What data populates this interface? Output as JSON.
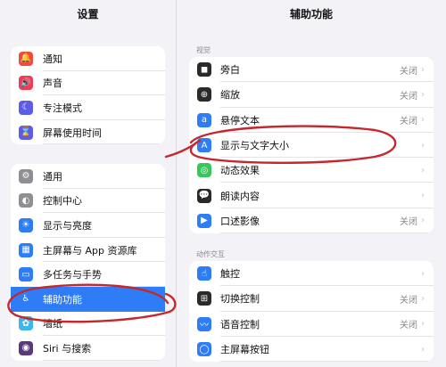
{
  "sidebar": {
    "title": "设置",
    "group1": [
      {
        "label": "通知",
        "icon": "bell-icon",
        "color": "#f24b3e",
        "glyph": "🔔"
      },
      {
        "label": "声音",
        "icon": "speaker-icon",
        "color": "#f23b54",
        "glyph": "🔊"
      },
      {
        "label": "专注模式",
        "icon": "moon-icon",
        "color": "#5e5ce6",
        "glyph": "☾"
      },
      {
        "label": "屏幕使用时间",
        "icon": "hourglass-icon",
        "color": "#5e5ce6",
        "glyph": "⌛"
      }
    ],
    "group2": [
      {
        "label": "通用",
        "icon": "gear-icon",
        "color": "#8e8e93",
        "glyph": "⚙"
      },
      {
        "label": "控制中心",
        "icon": "toggles-icon",
        "color": "#8e8e93",
        "glyph": "◐"
      },
      {
        "label": "显示与亮度",
        "icon": "sun-icon",
        "color": "#2e7df6",
        "glyph": "☀"
      },
      {
        "label": "主屏幕与 App 资源库",
        "icon": "home-grid-icon",
        "color": "#2e7df6",
        "glyph": "▦"
      },
      {
        "label": "多任务与手势",
        "icon": "multitask-icon",
        "color": "#2e7df6",
        "glyph": "▭"
      },
      {
        "label": "辅助功能",
        "icon": "accessibility-icon",
        "color": "#2e7df6",
        "glyph": "♿",
        "selected": true
      },
      {
        "label": "墙纸",
        "icon": "flower-icon",
        "color": "#3fb6e8",
        "glyph": "✿"
      },
      {
        "label": "Siri 与搜索",
        "icon": "siri-icon",
        "color": "#5a3b7a",
        "glyph": "◉"
      }
    ]
  },
  "detail": {
    "title": "辅助功能",
    "section1_header": "视觉",
    "section1": [
      {
        "label": "旁白",
        "value": "关闭",
        "icon": "voiceover-icon",
        "color": "#2a2a2a",
        "glyph": "◼"
      },
      {
        "label": "缩放",
        "value": "关闭",
        "icon": "zoom-icon",
        "color": "#2a2a2a",
        "glyph": "⊕"
      },
      {
        "label": "悬停文本",
        "value": "关闭",
        "icon": "hover-text-icon",
        "color": "#2e7df6",
        "glyph": "a"
      },
      {
        "label": "显示与文字大小",
        "value": "",
        "icon": "text-size-icon",
        "color": "#2e7df6",
        "glyph": "A"
      },
      {
        "label": "动态效果",
        "value": "",
        "icon": "motion-icon",
        "color": "#34c759",
        "glyph": "◎"
      },
      {
        "label": "朗读内容",
        "value": "",
        "icon": "speech-bubble-icon",
        "color": "#2a2a2a",
        "glyph": "💬"
      },
      {
        "label": "口述影像",
        "value": "关闭",
        "icon": "audio-description-icon",
        "color": "#2e7df6",
        "glyph": "▶"
      }
    ],
    "section2_header": "动作交互",
    "section2": [
      {
        "label": "触控",
        "value": "",
        "icon": "hand-touch-icon",
        "color": "#2e7df6",
        "glyph": "☝"
      },
      {
        "label": "切换控制",
        "value": "关闭",
        "icon": "switch-control-icon",
        "color": "#2a2a2a",
        "glyph": "⊞"
      },
      {
        "label": "语音控制",
        "value": "关闭",
        "icon": "voice-control-icon",
        "color": "#2e7df6",
        "glyph": "〰"
      },
      {
        "label": "主屏幕按钮",
        "value": "",
        "icon": "home-button-icon",
        "color": "#2e7df6",
        "glyph": "◯"
      }
    ]
  }
}
